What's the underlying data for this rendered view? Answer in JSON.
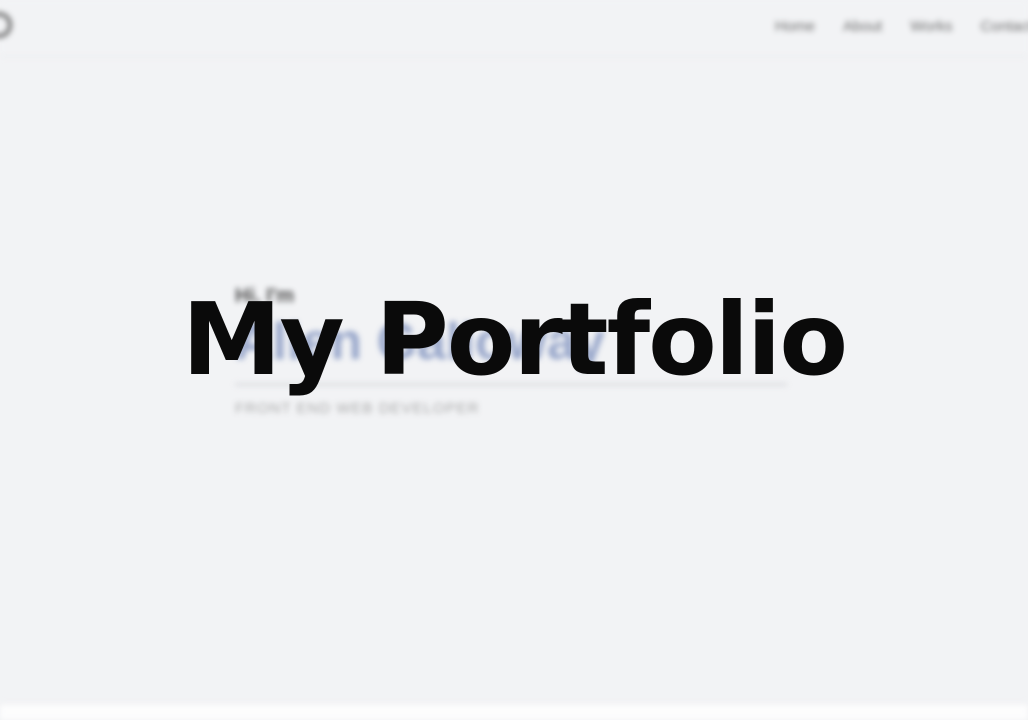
{
  "nav": {
    "logo_icon": "circle-logo-icon",
    "links": [
      {
        "label": "Home"
      },
      {
        "label": "About"
      },
      {
        "label": "Works"
      },
      {
        "label": "Contact"
      }
    ]
  },
  "hero": {
    "greeting": "Hi, I'm",
    "name": "Allen Galloway",
    "role": "FRONT END WEB DEVELOPER"
  },
  "overlay": {
    "title": "My Portfolio"
  },
  "colors": {
    "background": "#f2f3f5",
    "title": "#0a0a0a",
    "name_accent": "#8a9bc4"
  }
}
